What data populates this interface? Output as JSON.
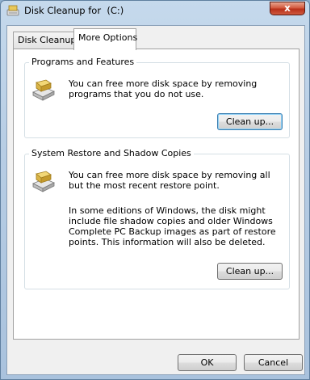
{
  "window": {
    "title": "Disk Cleanup for  (C:)",
    "close_glyph": "x"
  },
  "tabs": [
    {
      "label": "Disk Cleanup",
      "selected": false
    },
    {
      "label": "More Options",
      "selected": true
    }
  ],
  "programs_group": {
    "title": "Programs and Features",
    "icon": "drive-icon",
    "description": "You can free more disk space by removing programs that you do not use.",
    "button_label": "Clean up..."
  },
  "restore_group": {
    "title": "System Restore and Shadow Copies",
    "icon": "drive-icon",
    "description": "You can free more disk space by removing all but the most recent restore point.",
    "details": "In some editions of Windows, the disk might include file shadow copies and older Windows Complete PC Backup images as part of restore points. This information will also be deleted.",
    "button_label": "Clean up..."
  },
  "footer": {
    "ok_label": "OK",
    "cancel_label": "Cancel"
  },
  "colors": {
    "title_bar": "#b7cde4",
    "close_button": "#c94a30",
    "dialog_face": "#f0f0f0",
    "panel": "#ffffff",
    "default_button_border": "#3c7fb1"
  }
}
